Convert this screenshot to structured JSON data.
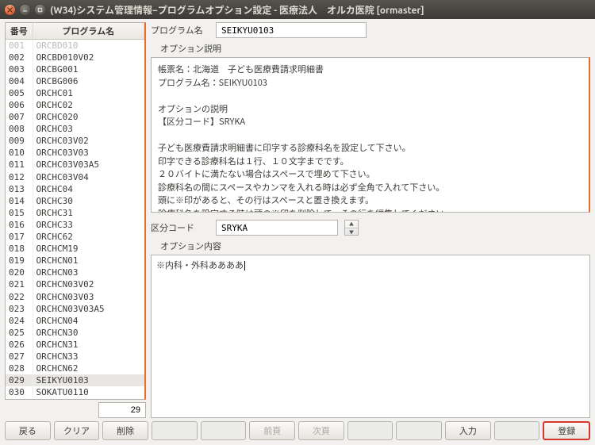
{
  "window": {
    "title": "(W34)システム管理情報−プログラムオプション設定 - 医療法人　オルカ医院  [ormaster]"
  },
  "left": {
    "col_no": "番号",
    "col_name": "プログラム名",
    "row_count": "29",
    "rows": [
      {
        "no": "001",
        "name": "ORCBD010"
      },
      {
        "no": "002",
        "name": "ORCBD010V02"
      },
      {
        "no": "003",
        "name": "ORCBG001"
      },
      {
        "no": "004",
        "name": "ORCBG006"
      },
      {
        "no": "005",
        "name": "ORCHC01"
      },
      {
        "no": "006",
        "name": "ORCHC02"
      },
      {
        "no": "007",
        "name": "ORCHC020"
      },
      {
        "no": "008",
        "name": "ORCHC03"
      },
      {
        "no": "009",
        "name": "ORCHC03V02"
      },
      {
        "no": "010",
        "name": "ORCHC03V03"
      },
      {
        "no": "011",
        "name": "ORCHC03V03A5"
      },
      {
        "no": "012",
        "name": "ORCHC03V04"
      },
      {
        "no": "013",
        "name": "ORCHC04"
      },
      {
        "no": "014",
        "name": "ORCHC30"
      },
      {
        "no": "015",
        "name": "ORCHC31"
      },
      {
        "no": "016",
        "name": "ORCHC33"
      },
      {
        "no": "017",
        "name": "ORCHC62"
      },
      {
        "no": "018",
        "name": "ORCHCM19"
      },
      {
        "no": "019",
        "name": "ORCHCN01"
      },
      {
        "no": "020",
        "name": "ORCHCN03"
      },
      {
        "no": "021",
        "name": "ORCHCN03V02"
      },
      {
        "no": "022",
        "name": "ORCHCN03V03"
      },
      {
        "no": "023",
        "name": "ORCHCN03V03A5"
      },
      {
        "no": "024",
        "name": "ORCHCN04"
      },
      {
        "no": "025",
        "name": "ORCHCN30"
      },
      {
        "no": "026",
        "name": "ORCHCN31"
      },
      {
        "no": "027",
        "name": "ORCHCN33"
      },
      {
        "no": "028",
        "name": "ORCHCN62"
      },
      {
        "no": "029",
        "name": "SEIKYU0103"
      },
      {
        "no": "030",
        "name": "SOKATU0110"
      }
    ],
    "selected_no": "029"
  },
  "right": {
    "program_label": "プログラム名",
    "program_value": "SEIKYU0103",
    "desc_label": "オプション説明",
    "desc_text": "帳票名：北海道　子ども医療費請求明細書\nプログラム名：SEIKYU0103\n\nオプションの説明\n【区分コード】SRYKA\n\n子ども医療費請求明細書に印字する診療科名を設定して下さい。\n印字できる診療科名は１行、１０文字までです。\n２０バイトに満たない場合はスペースで埋めて下さい。\n診療科名の間にスペースやカンマを入れる時は必ず全角で入れて下さい。\n頭に※印があると、その行はスペースと置き換えます。\n診療科名を設定する時は頭の※印を削除して、その行を編集してください。\n\n例　　※内科・外科ああああ\n　　　　　↓\n　　　　内科・外科",
    "code_label": "区分コード",
    "code_value": "SRYKA",
    "content_label": "オプション内容",
    "content_value": "※内科・外科ああああ"
  },
  "buttons": {
    "back": "戻る",
    "clear": "クリア",
    "delete": "削除",
    "prev": "前頁",
    "next": "次頁",
    "input": "入力",
    "register": "登録"
  }
}
